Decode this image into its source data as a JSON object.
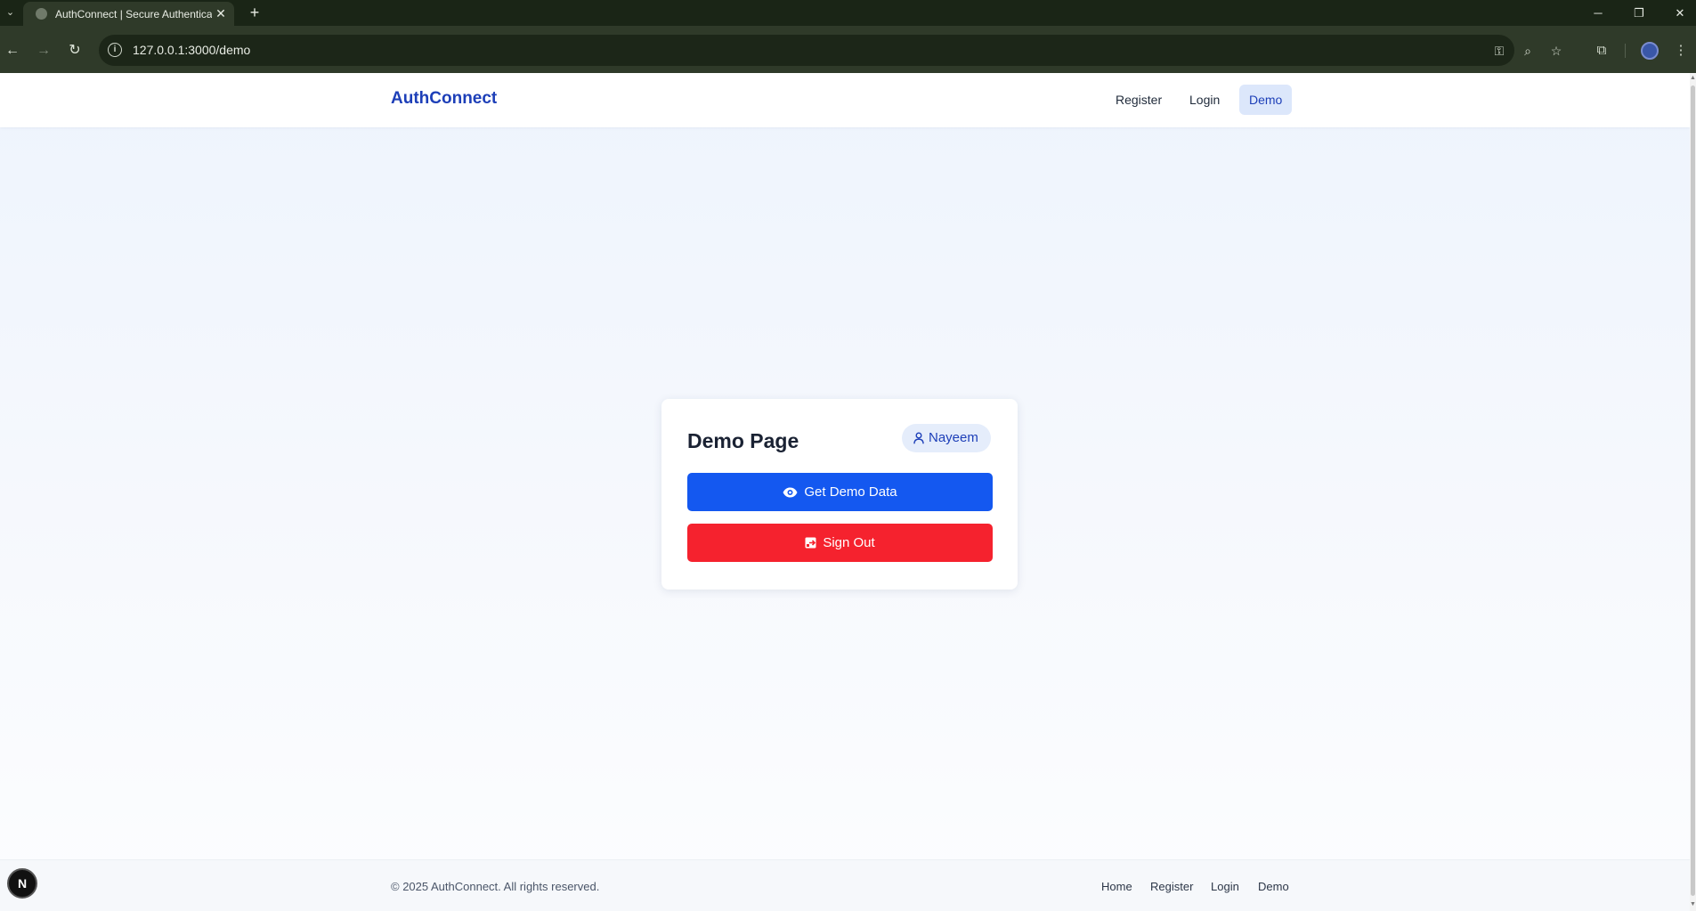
{
  "browser": {
    "tab_title": "AuthConnect | Secure Authentication",
    "url": "127.0.0.1:3000/demo",
    "new_tab_glyph": "+",
    "close_glyph": "✕"
  },
  "header": {
    "brand": "AuthConnect",
    "nav": [
      {
        "label": "Register"
      },
      {
        "label": "Login"
      },
      {
        "label": "Demo",
        "active": true
      }
    ]
  },
  "card": {
    "title": "Demo Page",
    "user_name": "Nayeem",
    "get_demo_label": "Get Demo Data",
    "sign_out_label": "Sign Out"
  },
  "footer": {
    "copyright": "© 2025 AuthConnect. All rights reserved.",
    "links": [
      {
        "label": "Home"
      },
      {
        "label": "Register"
      },
      {
        "label": "Login"
      },
      {
        "label": "Demo"
      }
    ]
  },
  "dev_badge": "N",
  "colors": {
    "brand": "#1d3fb8",
    "primary_button": "#1458f0",
    "danger_button": "#f5222e",
    "active_nav_bg": "#dce7fb",
    "browser_frame": "#2f3a29"
  },
  "icons": {
    "user_badge": "user-icon",
    "get_demo": "eye-icon",
    "sign_out": "sign-out-icon"
  }
}
